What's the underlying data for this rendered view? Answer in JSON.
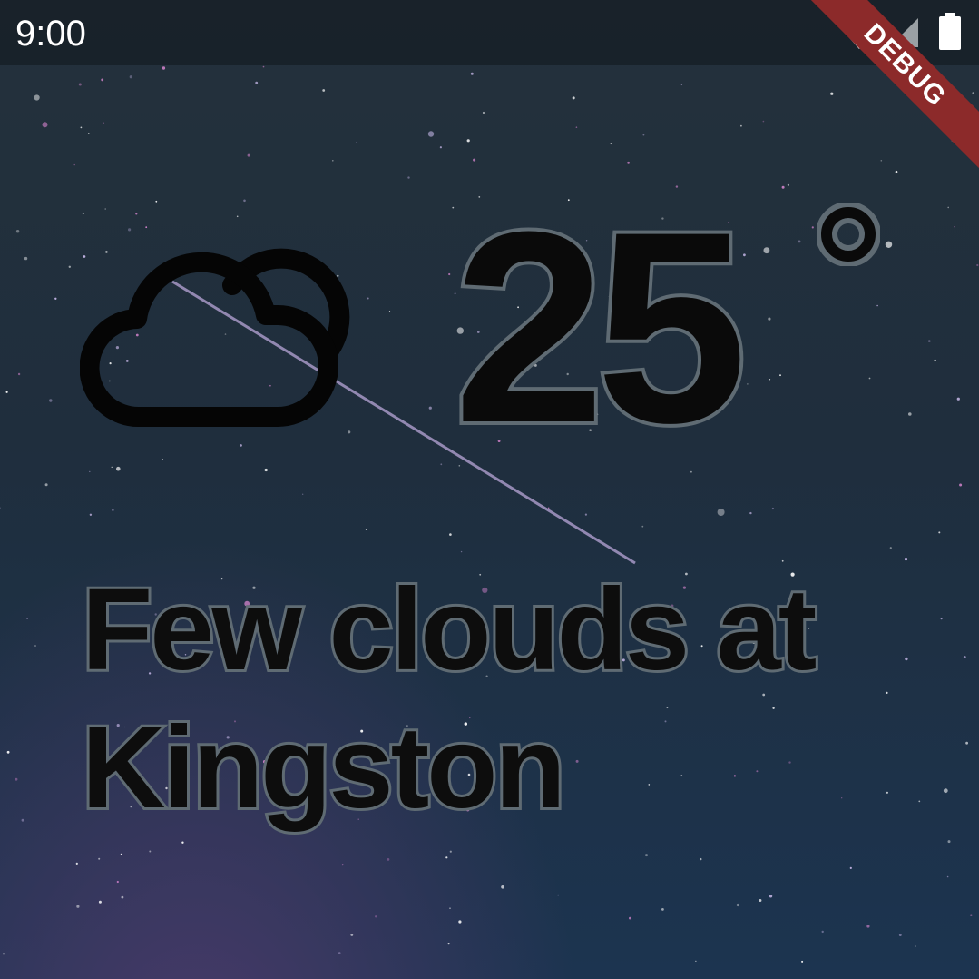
{
  "status_bar": {
    "time": "9:00",
    "icons": [
      "wifi-icon",
      "cellular-signal-icon",
      "battery-icon"
    ]
  },
  "debug_banner": {
    "label": "DEBUG"
  },
  "weather": {
    "condition_icon": "cloud-sun-icon",
    "temperature": "25",
    "degree_symbol": "°",
    "description": "Few clouds at Kingston"
  },
  "colors": {
    "text_fill": "#0a0a0a",
    "text_outline": "#5f6b73",
    "debug_banner": "#8c2a2a",
    "background_top": "#24313c",
    "background_bottom": "#1c3450"
  }
}
